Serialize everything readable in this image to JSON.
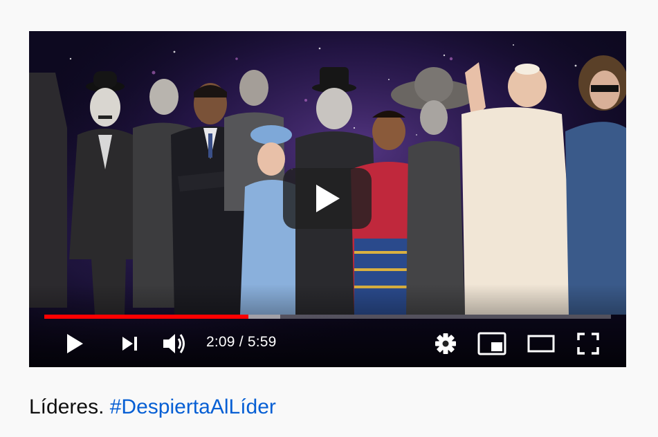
{
  "player": {
    "current_time": "2:09",
    "separator": "/",
    "duration": "5:59",
    "progress_played": 0.36,
    "progress_buffered": 0.416,
    "colors": {
      "played": "#ff0000",
      "accent_link": "#065fd4"
    }
  },
  "controls": {
    "play_icon": "play-icon",
    "next_icon": "next-icon",
    "volume_icon": "volume-icon",
    "settings_icon": "gear-icon",
    "miniplayer_icon": "miniplayer-icon",
    "theater_icon": "theater-mode-icon",
    "fullscreen_icon": "fullscreen-icon"
  },
  "caption": {
    "text": "Líderes.",
    "hashtag": "#DespiertaAlLíder"
  }
}
